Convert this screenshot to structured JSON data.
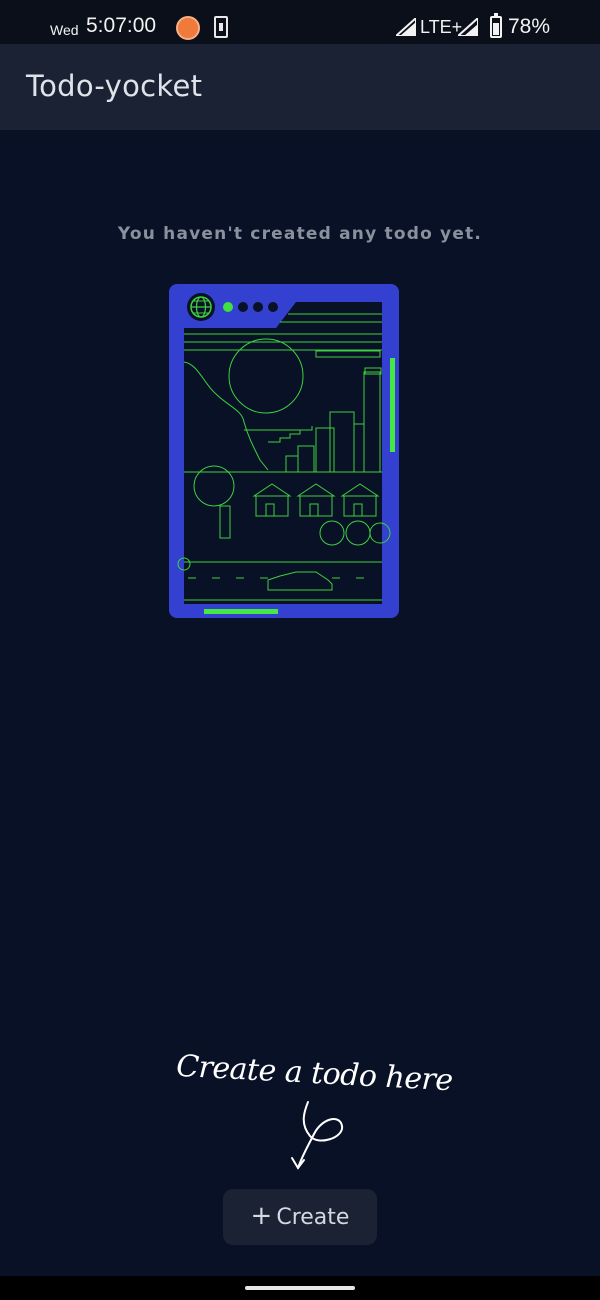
{
  "status_bar": {
    "day": "Wed",
    "time": "5:07:00",
    "network": "LTE+",
    "battery": "78%"
  },
  "app_bar": {
    "title": "Todo-yocket"
  },
  "empty_state": {
    "message": "You haven't created any todo yet."
  },
  "hint": {
    "text": "Create a todo here"
  },
  "create_button": {
    "icon": "plus-icon",
    "label": "Create"
  },
  "colors": {
    "background": "#081125",
    "app_bar": "#1b2234",
    "illustration_frame": "#3340d0",
    "illustration_line": "#3fd040",
    "accent_green": "#45e845"
  }
}
